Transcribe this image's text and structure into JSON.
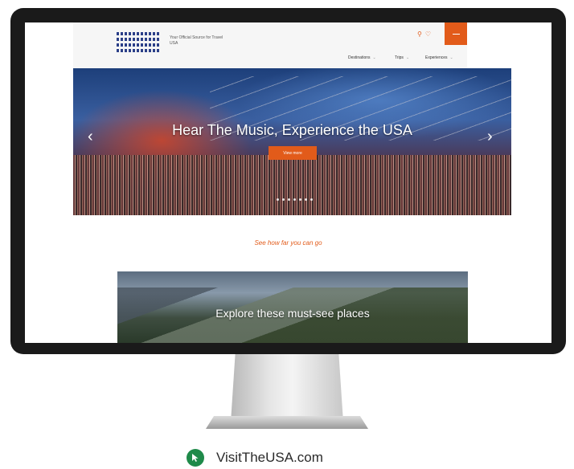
{
  "website": {
    "header": {
      "tagline": "Your Official Source for Travel USA",
      "icons": [
        "search-icon",
        "heart-icon"
      ],
      "nav": [
        {
          "label": "Destinations"
        },
        {
          "label": "Trips"
        },
        {
          "label": "Experiences"
        }
      ]
    },
    "hero": {
      "title": "Hear The Music, Experience the USA",
      "button_label": "View more",
      "slide_count": 7
    },
    "tagline_link": "See how far you can go",
    "explore": {
      "title": "Explore these must-see places"
    }
  },
  "caption": {
    "url": "VisitTheUSA.com"
  },
  "colors": {
    "accent": "#e25b1a",
    "bezel": "#1a1a1a",
    "caption_badge": "#1f8a4a"
  }
}
